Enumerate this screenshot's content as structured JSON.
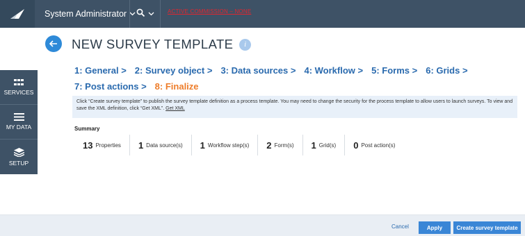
{
  "header": {
    "user_menu": "System Administrator",
    "search_icon": "search-icon",
    "active_link": "ACTIVE COMMISSION – NONE"
  },
  "sidebar": {
    "items": [
      {
        "label": "SERVICES",
        "icon": "services-grid-icon"
      },
      {
        "label": "MY DATA",
        "icon": "hamburger-icon"
      },
      {
        "label": "SETUP",
        "icon": "layers-icon"
      }
    ]
  },
  "page": {
    "title": "NEW SURVEY TEMPLATE",
    "info_icon": "i"
  },
  "steps": [
    "1: General >",
    "2: Survey object >",
    "3: Data sources >",
    "4: Workflow >",
    "5: Forms >",
    "6: Grids >",
    "7: Post actions >",
    "8: Finalize"
  ],
  "active_step": "8: Finalize",
  "info": {
    "text": "Click “Create survey template” to publish the survey template definition as a process template. You may need to change the security for the process template to allow users to launch surveys. To view and save the XML definition, click “Get XML”.",
    "link": "Get XML"
  },
  "summary": {
    "label": "Summary",
    "items": [
      {
        "count": "13",
        "label": "Properties"
      },
      {
        "count": "1",
        "label": "Data source(s)"
      },
      {
        "count": "1",
        "label": "Workflow step(s)"
      },
      {
        "count": "2",
        "label": "Form(s)"
      },
      {
        "count": "1",
        "label": "Grid(s)"
      },
      {
        "count": "0",
        "label": "Post action(s)"
      }
    ]
  },
  "footer": {
    "cancel": "Cancel",
    "apply": "Apply",
    "create": "Create survey template"
  },
  "colors": {
    "topbar": "#3e5266",
    "link": "#2a6aae",
    "active_step": "#ee7d2a",
    "button": "#3a86d6"
  }
}
